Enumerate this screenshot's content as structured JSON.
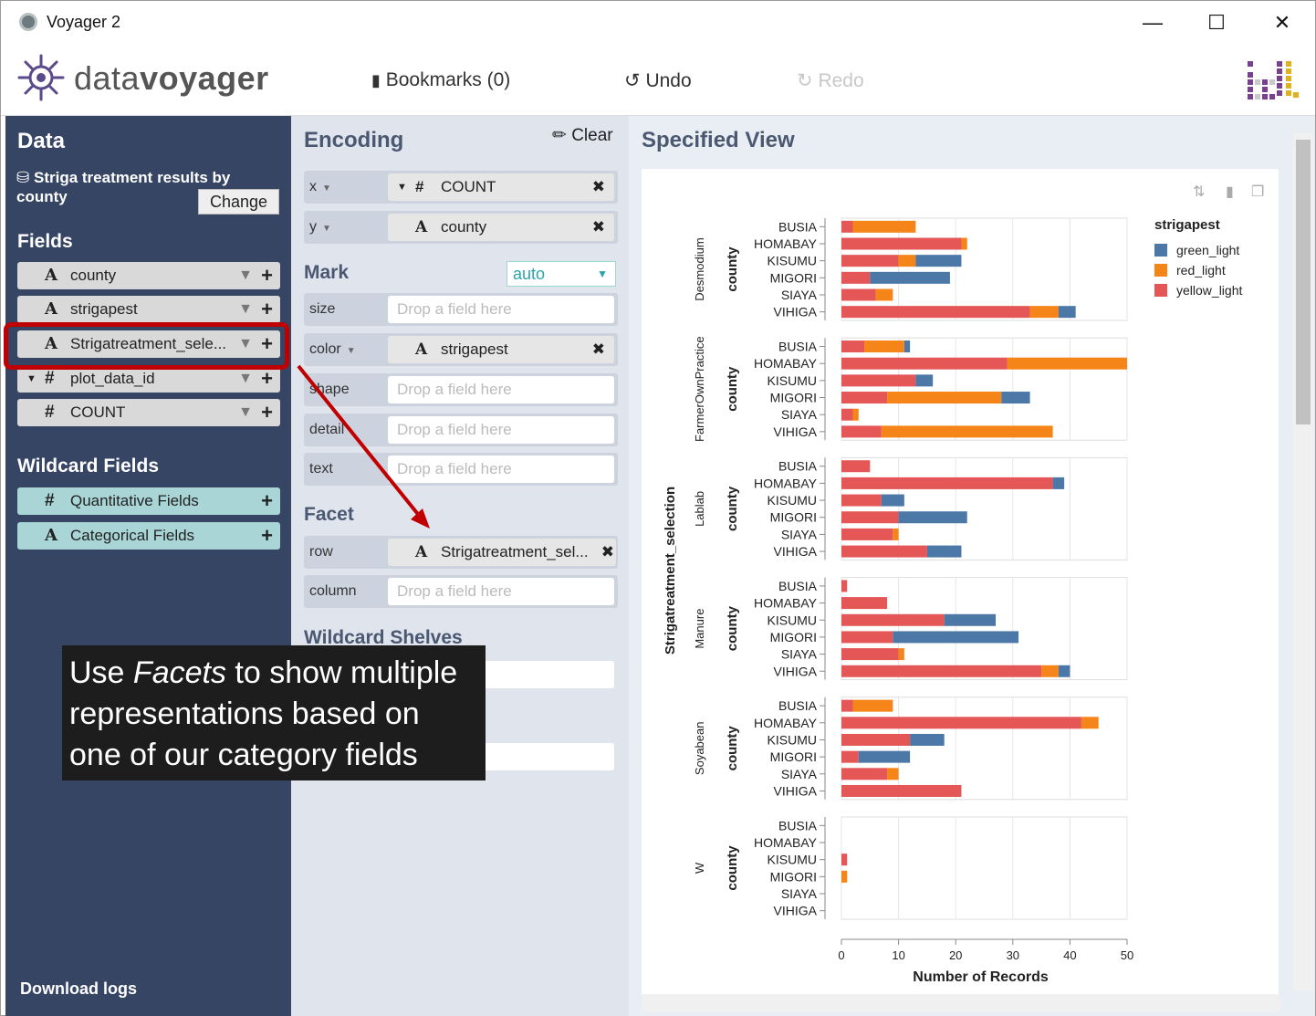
{
  "window": {
    "title": "Voyager 2",
    "min": "—",
    "max": "☐",
    "close": "✕"
  },
  "header": {
    "logo_light": "data",
    "logo_bold": "voyager",
    "bookmarks": "Bookmarks (0)",
    "undo": "Undo",
    "redo": "Redo"
  },
  "data_panel": {
    "title": "Data",
    "dataset": "Striga treatment results by county",
    "change": "Change",
    "fields_title": "Fields",
    "fields": [
      {
        "type": "A",
        "name": "county"
      },
      {
        "type": "A",
        "name": "strigapest"
      },
      {
        "type": "A",
        "name": "Strigatreatment_sele..."
      },
      {
        "type": "#",
        "name": "plot_data_id"
      },
      {
        "type": "#",
        "name": "COUNT"
      }
    ],
    "wildcard_title": "Wildcard Fields",
    "wildcards": [
      {
        "type": "#",
        "name": "Quantitative Fields"
      },
      {
        "type": "A",
        "name": "Categorical Fields"
      }
    ],
    "download": "Download logs"
  },
  "encoding": {
    "title": "Encoding",
    "clear": "Clear",
    "x": {
      "label": "x",
      "field": "COUNT",
      "type": "#"
    },
    "y": {
      "label": "y",
      "field": "county",
      "type": "A"
    },
    "mark_title": "Mark",
    "mark_value": "auto",
    "size": "size",
    "color": {
      "label": "color",
      "field": "strigapest",
      "type": "A"
    },
    "shape": "shape",
    "detail": "detail",
    "text": "text",
    "drop": "Drop a field here",
    "facet_title": "Facet",
    "row": {
      "label": "row",
      "field": "Strigatreatment_sel...",
      "type": "A"
    },
    "column": "column",
    "wildcard_title": "Wildcard Shelves",
    "wild_drop": "eld here",
    "wild_drop2": "re"
  },
  "view": {
    "title": "Specified View"
  },
  "callout": {
    "pre": "Use ",
    "em": "Facets",
    "post": " to show multiple representations based on one of our category fields"
  },
  "chart_data": {
    "type": "bar",
    "stacked": true,
    "orientation": "horizontal",
    "x_label": "Number of Records",
    "x_ticks": [
      0,
      10,
      20,
      30,
      40,
      50
    ],
    "xlim": [
      0,
      50
    ],
    "row_title": "Strigatreatment_selection",
    "y_title": "county",
    "categories": [
      "BUSIA",
      "HOMABAY",
      "KISUMU",
      "MIGORI",
      "SIAYA",
      "VIHIGA"
    ],
    "legend_title": "strigapest",
    "legend": [
      {
        "name": "green_light",
        "color": "#4c78a8"
      },
      {
        "name": "red_light",
        "color": "#f58518"
      },
      {
        "name": "yellow_light",
        "color": "#e45756"
      }
    ],
    "facets": [
      {
        "name": "Desmodium",
        "values": {
          "yellow_light": [
            2,
            21,
            10,
            5,
            6,
            33
          ],
          "red_light": [
            11,
            1,
            3,
            0,
            3,
            5
          ],
          "green_light": [
            0,
            0,
            8,
            14,
            0,
            3
          ]
        }
      },
      {
        "name": "FarmerOwnPractice",
        "values": {
          "yellow_light": [
            4,
            29,
            13,
            8,
            2,
            7
          ],
          "red_light": [
            7,
            21,
            0,
            20,
            1,
            30
          ],
          "green_light": [
            1,
            0,
            3,
            5,
            0,
            0
          ]
        }
      },
      {
        "name": "Lablab",
        "values": {
          "yellow_light": [
            5,
            37,
            7,
            10,
            9,
            15
          ],
          "red_light": [
            0,
            0,
            0,
            0,
            1,
            0
          ],
          "green_light": [
            0,
            2,
            4,
            12,
            0,
            6
          ]
        }
      },
      {
        "name": "Manure",
        "values": {
          "yellow_light": [
            1,
            8,
            18,
            9,
            10,
            35
          ],
          "red_light": [
            0,
            0,
            0,
            0,
            1,
            3
          ],
          "green_light": [
            0,
            0,
            9,
            22,
            0,
            2
          ]
        }
      },
      {
        "name": "Soyabean",
        "values": {
          "yellow_light": [
            2,
            42,
            12,
            3,
            8,
            21
          ],
          "red_light": [
            7,
            3,
            0,
            0,
            2,
            0
          ],
          "green_light": [
            0,
            0,
            6,
            9,
            0,
            0
          ]
        }
      },
      {
        "name": "W",
        "values": {
          "yellow_light": [
            0,
            0,
            1,
            0,
            0,
            0
          ],
          "red_light": [
            0,
            0,
            0,
            1,
            0,
            0
          ],
          "green_light": [
            0,
            0,
            0,
            0,
            0,
            0
          ]
        }
      }
    ]
  }
}
